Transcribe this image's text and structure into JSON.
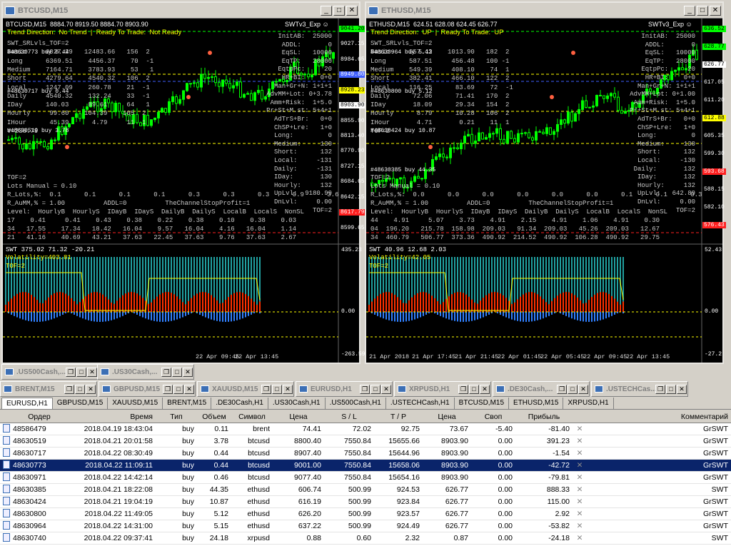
{
  "windows": [
    {
      "title": "BTCUSD,M15",
      "header": "BTCUSD,M15  8884.70 8919.50 8884.70 8903.90",
      "expert": "SWTv3_Exp ☺",
      "trend": "Trend Direction:  No Trend  |  Ready To Trade:  Not Ready",
      "lines": [
        "SWT_SRLvls_TOF=2",
        "Basic     6027.29   12483.66   156  2",
        "Long      6369.51    4456.37    70  -1",
        "Medium    7164.71    3783.93    53   1",
        "Short     4279.64    4540.32   106  2",
        "Local     1247.09    260.78    21  -1",
        "Daily     4540.32    132.24    33  -1",
        "IDay      140.03     89.61     64   1",
        "Hourly     99.60    104.39    105  2",
        "IHour      45.39      4.79     11  1",
        "V=236.79"
      ],
      "right": [
        "InitAB:  25000",
        "ADDL:       0",
        "EqSL:   10000",
        "EqTP:   28000",
        "EqtpPc:     20",
        "HR+BI:    0+0",
        "Man+Gr+N: 1+1+1",
        "AdvMM+Lot: 0+3.78",
        "Amm+Risk:  1+5.0",
        "Pr+St+M.st: 5+4+1",
        "AdTrS+Br:   0+0",
        "ChSP+Lre:   1+0",
        "Long:         0",
        "Medium:     130",
        "Short:      132",
        "Local:     -131",
        "Daily:     -131",
        "IDay:       130",
        "Hourly:     132",
        "UpLvl:  9180.99",
        "DnLvl:     0.00",
        "TOF=2"
      ],
      "lots": "Lots Manual = 0.10",
      "tof": "TOF=2",
      "rlots": "R_Lots,%:  0.1      0.1      0.1      0.1      0.3      0.3      0.3      0.9      3.6",
      "raum": "R_AuMM,% = 1.00          ADDL=0          TheChannelStopProfit=1",
      "tbl_hdr": "Level:  HourlyB  HourlyS  IDayB  IDayS  DailyB  DailyS  LocalB  LocalS  NonSL",
      "tbl_r1": "17    0.41     0.41    0.43    0.38    0.22    0.38    0.10    0.38    0.03",
      "tbl_r2": "34   17.55    17.34   18.42   16.04    9.57   16.04    4.16   16.04    1.14",
      "tbl_r3": "21   41.16    40.69   43.21   37.63   22.45   37.63    9.76   37.63    2.67",
      "orders": [
        "#48630773 buy 0.44",
        "#48630717 buy 0.44",
        "#48630519 buy 3.78"
      ],
      "prices": [
        "9041.20",
        "9027.15",
        "8984.65",
        "8949.80",
        "8928.23",
        "8903.90",
        "8855.90",
        "8813.40",
        "8770.90",
        "8727.15",
        "8684.65",
        "8642.15",
        "8617.79",
        "8599.65"
      ],
      "ind_title": "SWT 375.02 71.32 -20.21",
      "ind_vol": "Volatility=403.81",
      "ind_tof": "TOF=2",
      "ind_scale": [
        "435.23",
        "0.00",
        "-263.59"
      ],
      "times": [
        "22 Apr 09:45",
        "22 Apr 13:45"
      ]
    },
    {
      "title": "ETHUSD,M15",
      "header": "ETHUSD,M15  624.51 628.08 624.45 626.77",
      "expert": "SWTv3_Exp ☺",
      "trend": "Trend Direction:  UP  |  Ready To Trade:  UP",
      "lines": [
        "SWT_SRLvls_TOF=2",
        "Basic     557.43    1013.90   182  2",
        "Long      587.51     456.48   100 -1",
        "Medium    549.39     408.10    74  1",
        "Short     382.41     466.10   122  2",
        "Local     116.25      83.69    72  -1",
        "Daily      72.06      71.41   170  2",
        "IDay       18.09      29.34   154  2",
        "Hourly      8.79      10.28   106  2",
        "IHour       4.71       0.21    11  1",
        "TOF=2"
      ],
      "right": [
        "InitAB:  25000",
        "ADDL:       0",
        "EqSL:   10000",
        "EqTP:   28000",
        "EqtpPc:     20",
        "HR+BI:    0+0",
        "Man+Gr+N: 1+1+1",
        "AdvMM+Lot: 0+1.00",
        "Amm+Risk:  1+5.0",
        "Pr+St+M.st: 5+4+1",
        "AdTrS+Br:   0+0",
        "ChSP+Lre:   1+0",
        "Long:         0",
        "Medium:     130",
        "Short:      132",
        "Local:     -130",
        "Daily:       132",
        "IDay:       132",
        "Hourly:     132",
        "UpLvl:   642.89",
        "DnLvl:     0.00",
        "TOF=2"
      ],
      "lots": "Lots Manual = 0.10",
      "tof": "TOF=2",
      "rlots": "R_Lots,%:  0.0      0.0      0.0      0.0      0.0      0.0      0.1      0.1      0.3",
      "raum": "R_AuMM,% = 1.00          ADDL=0          TheChannelStopProfit=1",
      "tbl_hdr": "Level:  HourlyB  HourlyS  IDayB  IDayS  DailyB  DailyS  LocalB  LocalS  NonSL",
      "tbl_r1": "44    4.91     5.07    3.73    4.91    2.15    4.91    1.06    4.91    0.30",
      "tbl_r2": "04  196.20   215.78  158.98  209.03   91.34  209.03   45.26  209.03   12.67",
      "tbl_r3": "34  460.79   506.77  373.36  490.92  214.52  490.92  106.28  490.92   29.75",
      "orders": [
        "#48630964 buy 5.12",
        "#48630800 buy 5.12",
        "#48630424 buy 10.87",
        "#48630385 buy 44.35"
      ],
      "prices": [
        "636.52",
        "628.77",
        "626.77",
        "617.05",
        "611.20",
        "612.88",
        "605.35",
        "599.30",
        "593.68",
        "588.15",
        "582.10",
        "576.43"
      ],
      "ind_title": "SWT 40.96 12.68 2.03",
      "ind_vol": "Volatility=42.05",
      "ind_tof": "TOF=2",
      "ind_scale": [
        "52.43",
        "0.00",
        "-27.2"
      ],
      "times": [
        "21 Apr 2018",
        "21 Apr 17:45",
        "21 Apr 21:45",
        "22 Apr 01:45",
        "22 Apr 05:45",
        "22 Apr 09:45",
        "22 Apr 13:45"
      ]
    }
  ],
  "minimized": [
    ".US500Cash,...",
    ".US30Cash,...",
    "BRENT,M15",
    "GBPUSD,M15",
    "XAUUSD,M15",
    "EURUSD,H1",
    "XRPUSD,H1",
    ".DE30Cash,...",
    ".USTECHCas..."
  ],
  "tabs": [
    "EURUSD,H1",
    "GBPUSD,M15",
    "XAUUSD,M15",
    "BRENT,M15",
    ".DE30Cash,H1",
    ".US30Cash,H1",
    ".US500Cash,H1",
    ".USTECHCash,H1",
    "BTCUSD,M15",
    "ETHUSD,M15",
    "XRPUSD,H1"
  ],
  "table": {
    "headers": [
      "Ордер",
      "Время",
      "Тип",
      "Объем",
      "Символ",
      "Цена",
      "S / L",
      "T / P",
      "Цена",
      "Своп",
      "Прибыль",
      "",
      "Комментарий"
    ],
    "rows": [
      [
        "48586479",
        "2018.04.19 18:43:04",
        "buy",
        "0.11",
        "brent",
        "74.41",
        "72.02",
        "92.75",
        "73.67",
        "-5.40",
        "-81.40",
        "✕",
        "GrSWT"
      ],
      [
        "48630519",
        "2018.04.21 20:01:58",
        "buy",
        "3.78",
        "btcusd",
        "8800.40",
        "7550.84",
        "15655.66",
        "8903.90",
        "0.00",
        "391.23",
        "✕",
        "GrSWT"
      ],
      [
        "48630717",
        "2018.04.22 08:30:49",
        "buy",
        "0.44",
        "btcusd",
        "8907.40",
        "7550.84",
        "15644.96",
        "8903.90",
        "0.00",
        "-1.54",
        "✕",
        "GrSWT"
      ],
      [
        "48630773",
        "2018.04.22 11:09:11",
        "buy",
        "0.44",
        "btcusd",
        "9001.00",
        "7550.84",
        "15658.06",
        "8903.90",
        "0.00",
        "-42.72",
        "✕",
        "GrSWT"
      ],
      [
        "48630971",
        "2018.04.22 14:42:14",
        "buy",
        "0.46",
        "btcusd",
        "9077.40",
        "7550.84",
        "15654.16",
        "8903.90",
        "0.00",
        "-79.81",
        "✕",
        "GrSWT"
      ],
      [
        "48630385",
        "2018.04.21 18:22:08",
        "buy",
        "44.35",
        "ethusd",
        "606.74",
        "500.99",
        "924.53",
        "626.77",
        "0.00",
        "888.33",
        "✕",
        "SWT"
      ],
      [
        "48630424",
        "2018.04.21 19:04:19",
        "buy",
        "10.87",
        "ethusd",
        "616.19",
        "500.99",
        "923.84",
        "626.77",
        "0.00",
        "115.00",
        "✕",
        "GrSWT"
      ],
      [
        "48630800",
        "2018.04.22 11:49:05",
        "buy",
        "5.12",
        "ethusd",
        "626.20",
        "500.99",
        "923.57",
        "626.77",
        "0.00",
        "2.92",
        "✕",
        "GrSWT"
      ],
      [
        "48630964",
        "2018.04.22 14:31:00",
        "buy",
        "5.15",
        "ethusd",
        "637.22",
        "500.99",
        "924.49",
        "626.77",
        "0.00",
        "-53.82",
        "✕",
        "GrSWT"
      ],
      [
        "48630740",
        "2018.04.22 09:37:41",
        "buy",
        "24.18",
        "xrpusd",
        "0.88",
        "0.60",
        "2.32",
        "0.87",
        "0.00",
        "-24.18",
        "✕",
        "SWT"
      ]
    ]
  }
}
